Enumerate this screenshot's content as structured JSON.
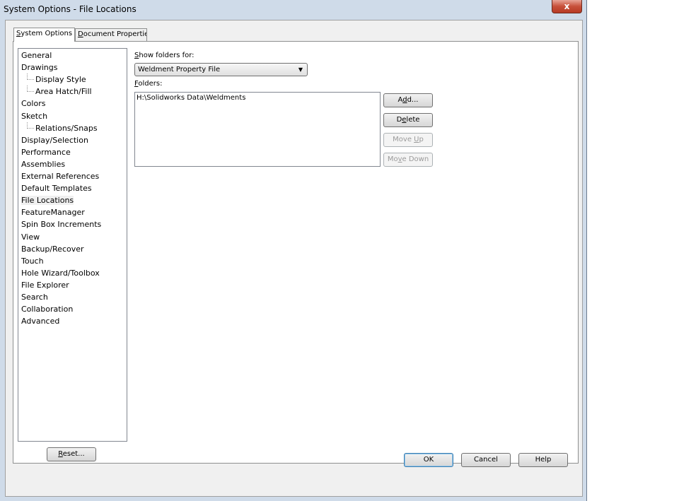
{
  "window": {
    "title": "System Options - File Locations",
    "close_glyph": "x"
  },
  "tabs": [
    {
      "label_pre": "",
      "label_ul": "S",
      "label_post": "ystem Options"
    },
    {
      "label_pre": "",
      "label_ul": "D",
      "label_post": "ocument Properties"
    }
  ],
  "tree": {
    "items": [
      "General",
      "Drawings",
      "Display Style",
      "Area Hatch/Fill",
      "Colors",
      "Sketch",
      "Relations/Snaps",
      "Display/Selection",
      "Performance",
      "Assemblies",
      "External References",
      "Default Templates",
      "File Locations",
      "FeatureManager",
      "Spin Box Increments",
      "View",
      "Backup/Recover",
      "Touch",
      "Hole Wizard/Toolbox",
      "File Explorer",
      "Search",
      "Collaboration",
      "Advanced"
    ],
    "selected": "File Locations"
  },
  "reset": {
    "pre": "",
    "ul": "R",
    "post": "eset..."
  },
  "show_folders": {
    "label_ul": "S",
    "label_post": "how folders for:",
    "value": "Weldment Property File"
  },
  "folders": {
    "label_ul": "F",
    "label_post": "olders:",
    "items": [
      "H:\\Solidworks Data\\Weldments"
    ]
  },
  "side_buttons": {
    "add": {
      "pre": "A",
      "ul": "d",
      "post": "d..."
    },
    "delete": {
      "pre": "D",
      "ul": "e",
      "post": "lete"
    },
    "move_up": {
      "pre": "Move ",
      "ul": "U",
      "post": "p"
    },
    "move_down": {
      "pre": "Mo",
      "ul": "v",
      "post": "e Down"
    }
  },
  "footer": {
    "ok": "OK",
    "cancel": "Cancel",
    "help": "Help"
  }
}
